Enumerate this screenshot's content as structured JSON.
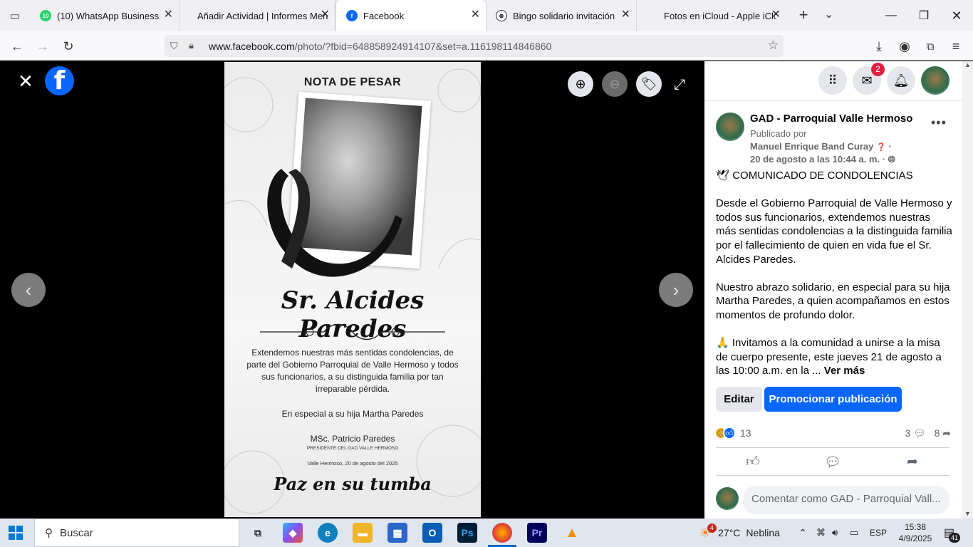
{
  "browser": {
    "tabs": [
      {
        "label": "(10) WhatsApp Business",
        "icon": "whatsapp-icon",
        "badge": "10"
      },
      {
        "label": "Añadir Actividad | Informes Mens",
        "icon": "none"
      },
      {
        "label": "Facebook",
        "icon": "facebook-icon"
      },
      {
        "label": "Bingo solidario invitación",
        "icon": "chatgpt-icon"
      },
      {
        "label": "Fotos en iCloud - Apple iClou",
        "icon": "apple-icon"
      }
    ],
    "url_domain": "www.facebook.com",
    "url_path": "/photo/?fbid=648858924914107&set=a.116198114846860"
  },
  "poster": {
    "title": "NOTA DE PESAR",
    "name": "Sr. Alcides Paredes",
    "body": "Extendemos nuestras más sentidas condolencias, de parte del Gobierno Parroquial de Valle Hermoso y todos sus funcionarios, a su distinguida familia por tan irreparable pérdida.",
    "hija": "En especial a su hija Martha Paredes",
    "signer": "MSc. Patricio Paredes",
    "role": "PRESIDENTE DEL GAD VALLE HERMOSO",
    "date": "Valle Hermoso, 20 de agosto del 2025",
    "closing": "Paz en su tumba"
  },
  "panel": {
    "messenger_badge": "2",
    "page_name": "GAD - Parroquial Valle Hermoso",
    "published_by": "Publicado por",
    "author": "Manuel Enrique Band Curay",
    "date": "20 de agosto a las 10:44 a. m. ·",
    "text_title": "COMUNICADO DE CONDOLENCIAS",
    "text_p1": "Desde el Gobierno Parroquial de Valle Hermoso y todos sus funcionarios, extendemos nuestras más sentidas condolencias a la distinguida familia por el fallecimiento de quien en vida fue el Sr. Alcides Paredes.",
    "text_p2": "Nuestro abrazo solidario, en especial para su hija Martha Paredes, a quien acompañamos en estos momentos de profundo dolor.",
    "text_p3": "Invitamos a la comunidad a unirse a la misa de cuerpo presente, este jueves 21 de agosto a las 10:00 a.m. en la ...",
    "see_more": "Ver más",
    "edit_label": "Editar",
    "promote_label": "Promocionar publicación",
    "reactions_count": "13",
    "comments_count": "3",
    "shares_count": "8",
    "comment_placeholder": "Comentar como GAD - Parroquial Vall..."
  },
  "taskbar": {
    "search_label": "Buscar",
    "weather_temp": "27°C",
    "weather_desc": "Neblina",
    "weather_badge": "4",
    "lang": "ESP",
    "time": "15:38",
    "date": "4/9/2025",
    "notif_count": "41"
  }
}
